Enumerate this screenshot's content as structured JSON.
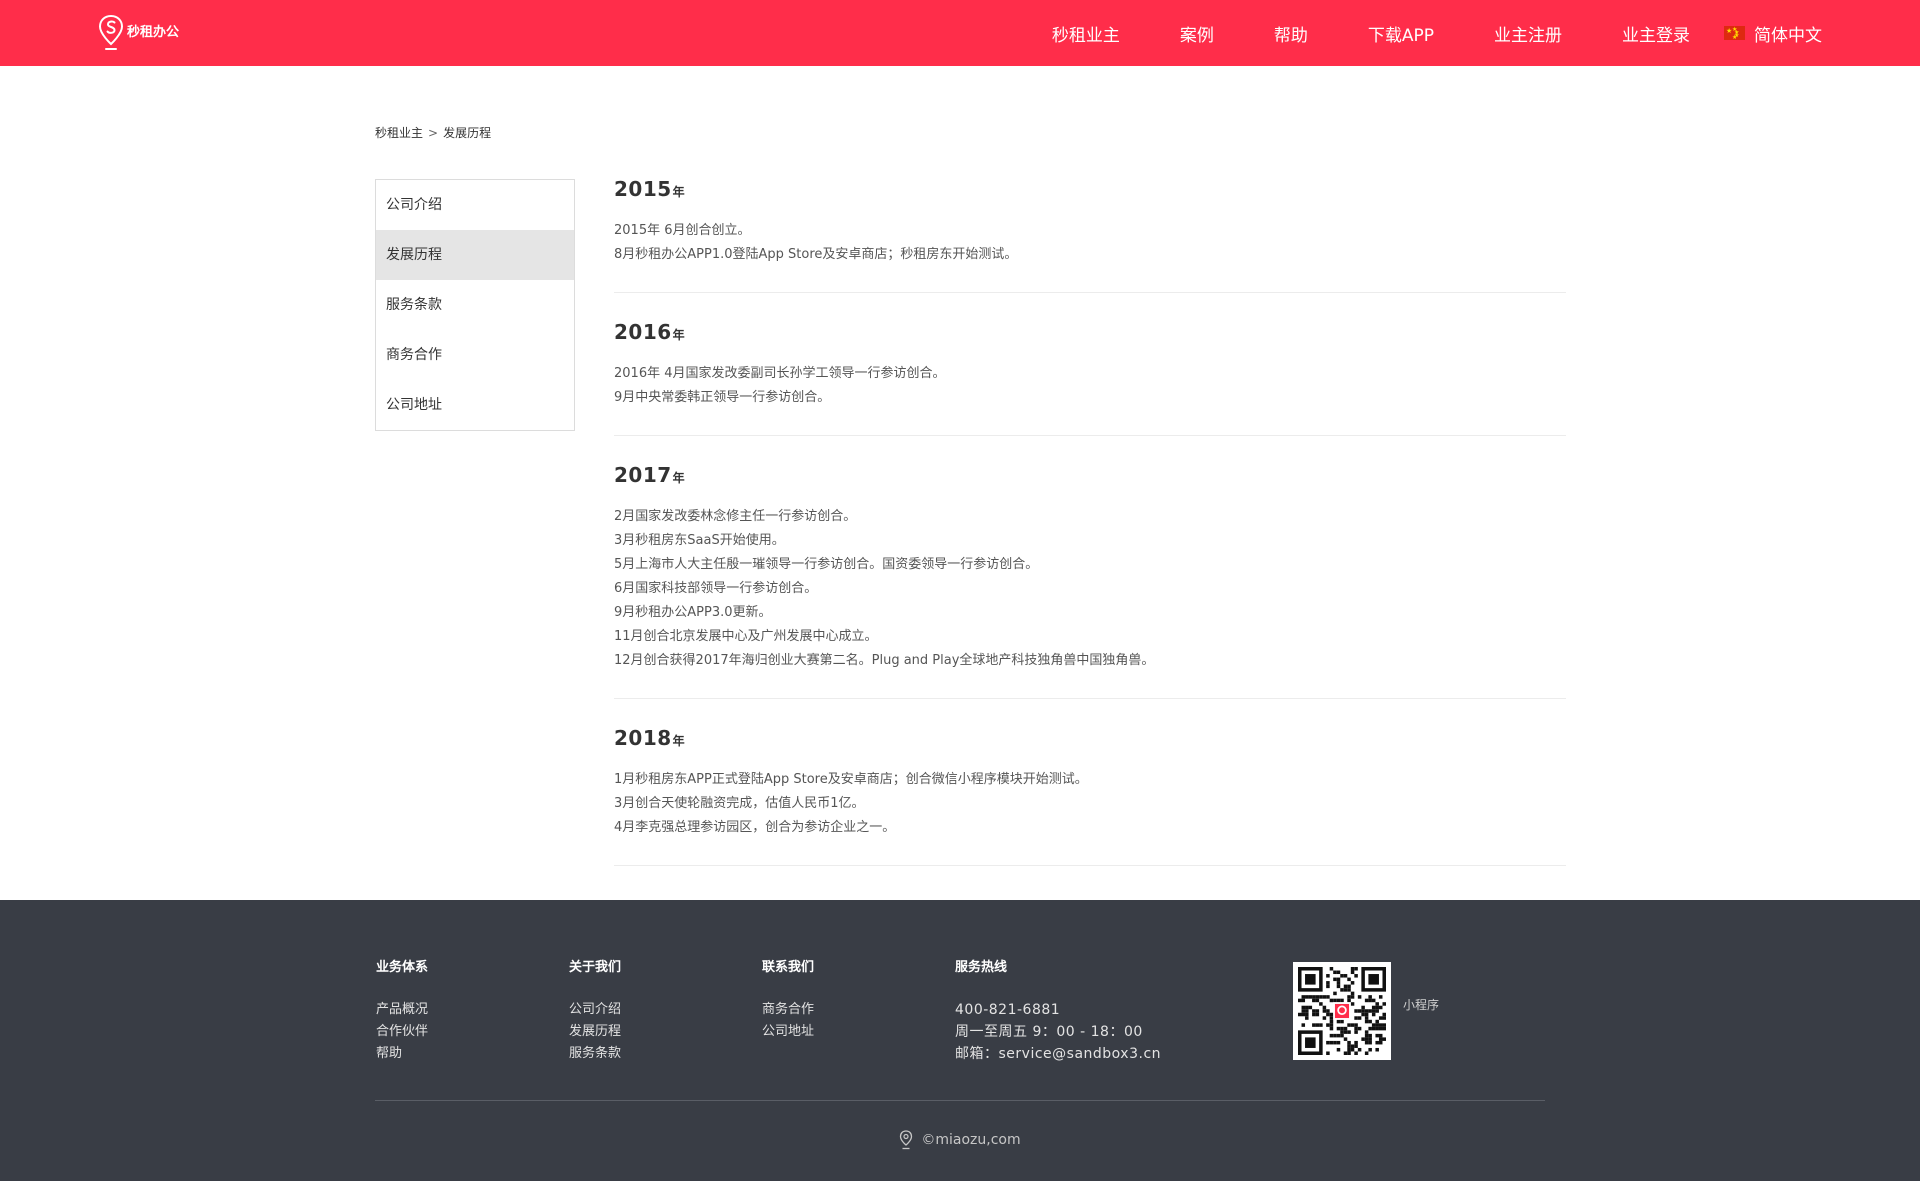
{
  "header": {
    "logo_text": "秒租办公",
    "nav": [
      "秒租业主",
      "案例",
      "帮助",
      "下载APP",
      "业主注册",
      "业主登录"
    ],
    "language": "简体中文"
  },
  "breadcrumb": {
    "root": "秒租业主",
    "separator": ">",
    "current": "发展历程"
  },
  "sidebar": {
    "items": [
      {
        "label": "公司介绍",
        "active": false
      },
      {
        "label": "发展历程",
        "active": true
      },
      {
        "label": "服务条款",
        "active": false
      },
      {
        "label": "商务合作",
        "active": false
      },
      {
        "label": "公司地址",
        "active": false
      }
    ]
  },
  "timeline": [
    {
      "year": "2015",
      "suffix": "年",
      "events": [
        "2015年 6月创合创立。",
        "8月秒租办公APP1.0登陆App Store及安卓商店；秒租房东开始测试。"
      ]
    },
    {
      "year": "2016",
      "suffix": "年",
      "events": [
        "2016年 4月国家发改委副司长孙学工领导一行参访创合。",
        "9月中央常委韩正领导一行参访创合。"
      ]
    },
    {
      "year": "2017",
      "suffix": "年",
      "events": [
        "2月国家发改委林念修主任一行参访创合。",
        "3月秒租房东SaaS开始使用。",
        "5月上海市人大主任殷一璀领导一行参访创合。国资委领导一行参访创合。",
        "6月国家科技部领导一行参访创合。",
        "9月秒租办公APP3.0更新。",
        "11月创合北京发展中心及广州发展中心成立。",
        "12月创合获得2017年海归创业大赛第二名。Plug and Play全球地产科技独角兽中国独角兽。"
      ]
    },
    {
      "year": "2018",
      "suffix": "年",
      "events": [
        "1月秒租房东APP正式登陆App Store及安卓商店；创合微信小程序模块开始测试。",
        "3月创合天使轮融资完成，估值人民币1亿。",
        "4月李克强总理参访园区，创合为参访企业之一。"
      ]
    }
  ],
  "footer": {
    "columns": [
      {
        "title": "业务体系",
        "items": [
          "产品概况",
          "合作伙伴",
          "帮助"
        ]
      },
      {
        "title": "关于我们",
        "items": [
          "公司介绍",
          "发展历程",
          "服务条款"
        ]
      },
      {
        "title": "联系我们",
        "items": [
          "商务合作",
          "公司地址"
        ]
      }
    ],
    "hotline": {
      "title": "服务热线",
      "phone": "400-821-6881",
      "hours": "周一至周五 9：00 - 18：00",
      "email": "邮箱：service@sandbox3.cn"
    },
    "qr_label": "小程序",
    "copyright": "©miaozu,com"
  },
  "colors": {
    "brand": "#ff2d4a",
    "footer_bg": "#393d45",
    "active_sidebar": "#e5e5e5"
  }
}
